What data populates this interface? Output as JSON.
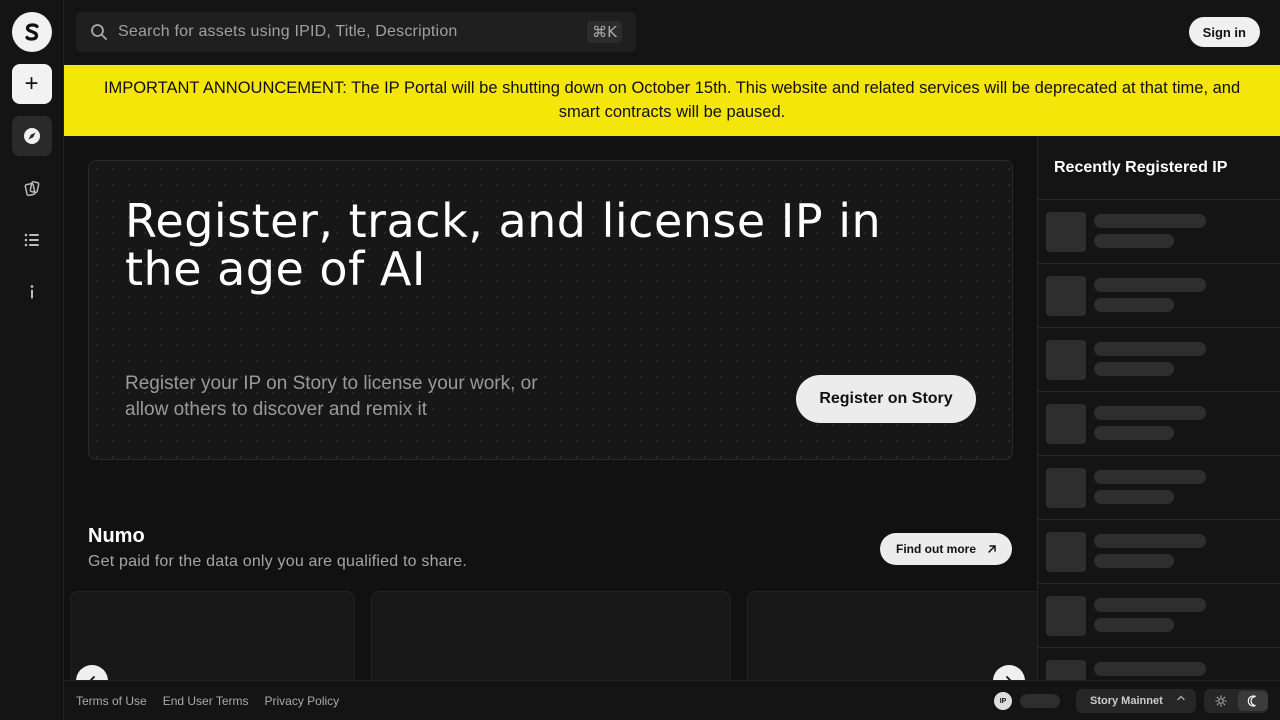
{
  "search": {
    "placeholder": "Search for assets using IPID, Title, Description",
    "shortcut": "⌘K"
  },
  "header": {
    "signin_label": "Sign in"
  },
  "announcement": {
    "text": "IMPORTANT ANNOUNCEMENT: The IP Portal will be shutting down on October 15th. This website and related services will be deprecated at that time, and smart contracts will be paused."
  },
  "hero": {
    "title": "Register, track, and license IP in the age of AI",
    "subtitle": "Register your IP on Story to license your work, or allow others to discover and remix it",
    "button_label": "Register on Story"
  },
  "section": {
    "title": "Numo",
    "subtitle": "Get paid for the data only you are qualified to share.",
    "button_label": "Find out more"
  },
  "recent": {
    "title": "Recently Registered IP"
  },
  "footer": {
    "links": [
      "Terms of Use",
      "End User Terms",
      "Privacy Policy"
    ],
    "ip_badge": "IP",
    "network_label": "Story Mainnet"
  },
  "colors": {
    "background": "#111111",
    "announcement": "#f5e60a",
    "button_light": "#ececec"
  }
}
